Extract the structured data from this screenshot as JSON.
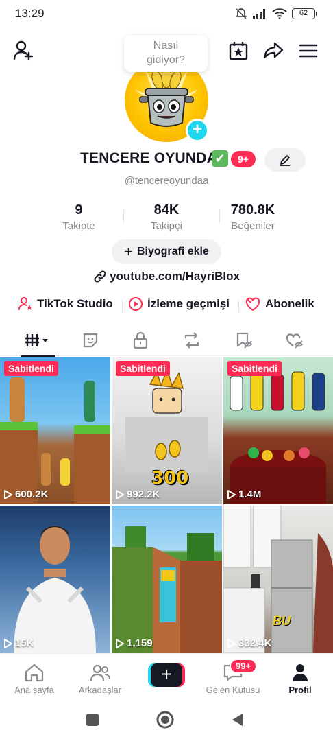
{
  "status_bar": {
    "time": "13:29",
    "battery": "62"
  },
  "header": {
    "bubble_line1": "Nasıl",
    "bubble_line2": "gidiyor?"
  },
  "profile": {
    "display_name": "TENCERE OYUNDA",
    "verified_glyph": "✔",
    "notification_badge": "9+",
    "username": "@tencereoyundaa",
    "avatar_plus": "+"
  },
  "stats": [
    {
      "value": "9",
      "label": "Takipte"
    },
    {
      "value": "84K",
      "label": "Takipçi"
    },
    {
      "value": "780.8K",
      "label": "Beğeniler"
    }
  ],
  "bio_button": {
    "plus": "+",
    "label": "Biyografi ekle"
  },
  "link": {
    "text": "youtube.com/HayriBlox"
  },
  "tools": [
    {
      "label": "TikTok Studio",
      "icon": "person-star-icon"
    },
    {
      "label": "İzleme geçmişi",
      "icon": "play-circle-icon"
    },
    {
      "label": "Abonelik",
      "icon": "heart-badge-icon"
    }
  ],
  "tabs": [
    {
      "icon": "grid-videos-icon",
      "active": true
    },
    {
      "icon": "sticker-icon"
    },
    {
      "icon": "lock-icon"
    },
    {
      "icon": "repost-icon"
    },
    {
      "icon": "bookmark-hidden-icon"
    },
    {
      "icon": "liked-hidden-icon"
    }
  ],
  "videos": [
    {
      "pinned_label": "Sabitlendi",
      "views": "600.2K"
    },
    {
      "pinned_label": "Sabitlendi",
      "views": "992.2K",
      "overlay_text": "300"
    },
    {
      "pinned_label": "Sabitlendi",
      "views": "1.4M"
    },
    {
      "views": "15K"
    },
    {
      "views": "1,159"
    },
    {
      "views": "332.4K",
      "overlay_text": "BU"
    }
  ],
  "bottom_nav": {
    "home": "Ana sayfa",
    "friends": "Arkadaşlar",
    "create": "+",
    "inbox": "Gelen Kutusu",
    "inbox_badge": "99+",
    "profile": "Profil"
  },
  "colors": {
    "accent": "#fe2c55",
    "cyan": "#20d5ec",
    "text": "#161823",
    "muted": "#8a8b91"
  }
}
